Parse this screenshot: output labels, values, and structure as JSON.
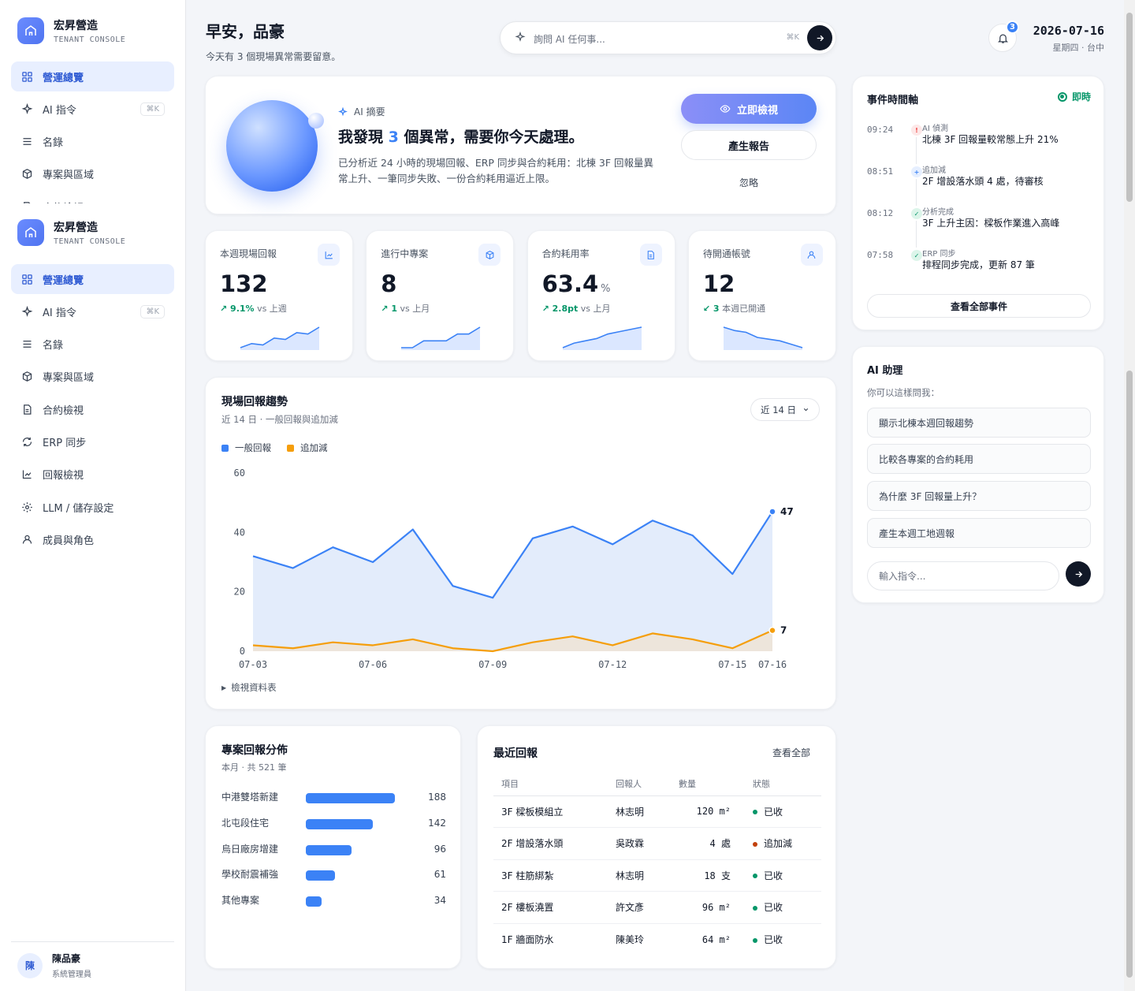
{
  "sidebar": {
    "brand_name": "宏昇營造",
    "brand_sub": "TENANT CONSOLE",
    "items": [
      {
        "label": "營運總覽",
        "icon": "grid-icon"
      },
      {
        "label": "AI 指令",
        "icon": "sparkle-icon",
        "kbd": "⌘K"
      },
      {
        "label": "名錄",
        "icon": "list-icon"
      },
      {
        "label": "專案與區域",
        "icon": "box-icon"
      },
      {
        "label": "合約檢視",
        "icon": "document-icon"
      },
      {
        "label": "ERP 同步",
        "icon": "sync-icon"
      },
      {
        "label": "回報檢視",
        "icon": "chart-icon"
      },
      {
        "label": "LLM / 儲存設定",
        "icon": "gear-icon"
      },
      {
        "label": "成員與角色",
        "icon": "user-icon"
      }
    ],
    "user": {
      "initial": "陳",
      "name": "陳品豪",
      "role": "系統管理員"
    }
  },
  "header": {
    "greeting": "早安，品豪",
    "subtitle": "今天有 3 個現場異常需要留意。",
    "search_placeholder": "詢問 AI 任何事...",
    "search_kbd": "⌘K",
    "notification_count": "3",
    "date": "2026-07-16",
    "weekday_location": "星期四 · 台中"
  },
  "ai_summary": {
    "tag": "AI 摘要",
    "headline_pre": "我發現 ",
    "headline_num": "3",
    "headline_post": " 個異常，需要你今天處理。",
    "body": "已分析近 24 小時的現場回報、ERP 同步與合約耗用：北棟 3F 回報量異常上升、一筆同步失敗、一份合約耗用逼近上限。",
    "primary_action": "立即檢視",
    "secondary_action": "產生報告",
    "dismiss": "忽略"
  },
  "kpis": [
    {
      "label": "本週現場回報",
      "value": "132",
      "unit": "",
      "delta": "↗ 9.1%",
      "delta_text": "vs 上週",
      "icon": "chart-icon",
      "trend": "up",
      "spark": [
        5,
        8,
        7,
        12,
        11,
        16,
        15,
        20
      ]
    },
    {
      "label": "進行中專案",
      "value": "8",
      "unit": "",
      "delta": "↗ 1",
      "delta_text": "vs 上月",
      "icon": "box-icon",
      "trend": "up",
      "spark": [
        6,
        6,
        10,
        10,
        10,
        14,
        14,
        18
      ]
    },
    {
      "label": "合約耗用率",
      "value": "63.4",
      "unit": "%",
      "delta": "↗ 2.8pt",
      "delta_text": "vs 上月",
      "icon": "document-icon",
      "trend": "up",
      "spark": [
        8,
        10,
        11,
        12,
        14,
        15,
        16,
        17
      ]
    },
    {
      "label": "待開通帳號",
      "value": "12",
      "unit": "",
      "delta": "↙ 3",
      "delta_text": "本週已開通",
      "icon": "user-icon",
      "trend": "down",
      "spark": [
        20,
        18,
        17,
        14,
        13,
        12,
        10,
        8
      ]
    }
  ],
  "trend": {
    "title": "現場回報趨勢",
    "subtitle": "近 14 日 · 一般回報與追加減",
    "range": "近 14 日",
    "table_toggle": "檢視資料表"
  },
  "chart_data": {
    "type": "area",
    "categories": [
      "07-03",
      "07-04",
      "07-05",
      "07-06",
      "07-07",
      "07-08",
      "07-09",
      "07-10",
      "07-11",
      "07-12",
      "07-13",
      "07-14",
      "07-15",
      "07-16"
    ],
    "x_ticks": [
      "07-03",
      "07-06",
      "07-09",
      "07-12",
      "07-15",
      "07-16"
    ],
    "series": [
      {
        "name": "一般回報",
        "color": "#3b82f6",
        "values": [
          32,
          28,
          35,
          30,
          41,
          22,
          18,
          38,
          42,
          36,
          44,
          39,
          26,
          47
        ]
      },
      {
        "name": "追加減",
        "color": "#f59e0b",
        "values": [
          2,
          1,
          3,
          2,
          4,
          1,
          0,
          3,
          5,
          2,
          6,
          4,
          1,
          7
        ]
      }
    ],
    "y_ticks": [
      0,
      20,
      40,
      60
    ],
    "ylim": [
      0,
      60
    ],
    "end_labels": [
      "47",
      "7"
    ],
    "grid": false,
    "legend": "top-left"
  },
  "distribution": {
    "title": "專案回報分佈",
    "subtitle": "本月 · 共 521 筆",
    "rows": [
      {
        "name": "中港雙塔新建",
        "value": 188
      },
      {
        "name": "北屯段住宅",
        "value": 142
      },
      {
        "name": "烏日廠房增建",
        "value": 96
      },
      {
        "name": "學校耐震補強",
        "value": 61
      },
      {
        "name": "其他專案",
        "value": 34
      }
    ]
  },
  "recent": {
    "title": "最近回報",
    "view_all": "查看全部",
    "headers": [
      "項目",
      "回報人",
      "數量",
      "狀態"
    ],
    "rows": [
      {
        "item": "3F 樑板模組立",
        "reporter": "林志明",
        "qty": "120 m²",
        "status": "已收",
        "status_color": "#059669"
      },
      {
        "item": "2F 增設落水頭",
        "reporter": "吳政霖",
        "qty": "4 處",
        "status": "追加減",
        "status_color": "#c2410c"
      },
      {
        "item": "3F 柱筋綁紮",
        "reporter": "林志明",
        "qty": "18 支",
        "status": "已收",
        "status_color": "#059669"
      },
      {
        "item": "2F 樓板澆置",
        "reporter": "許文彥",
        "qty": "96 m²",
        "status": "已收",
        "status_color": "#059669"
      },
      {
        "item": "1F 牆面防水",
        "reporter": "陳美玲",
        "qty": "64 m²",
        "status": "已收",
        "status_color": "#059669"
      }
    ]
  },
  "timeline": {
    "title": "事件時間軸",
    "live": "即時",
    "items": [
      {
        "time": "09:24",
        "tag": "AI 偵測",
        "text": "北棟 3F 回報量較常態上升 21%",
        "kind": "alert"
      },
      {
        "time": "08:51",
        "tag": "追加減",
        "text": "2F 增設落水頭 4 處，待審核",
        "kind": "add"
      },
      {
        "time": "08:12",
        "tag": "分析完成",
        "text": "3F 上升主因：樑板作業進入高峰",
        "kind": "done"
      },
      {
        "time": "07:58",
        "tag": "ERP 同步",
        "text": "排程同步完成，更新 87 筆",
        "kind": "done"
      }
    ],
    "view_all": "查看全部事件"
  },
  "assistant": {
    "title": "AI 助理",
    "hint": "你可以這樣問我：",
    "suggestions": [
      "顯示北棟本週回報趨勢",
      "比較各專案的合約耗用",
      "為什麼 3F 回報量上升？",
      "產生本週工地週報"
    ],
    "input_placeholder": "輸入指令..."
  },
  "colors": {
    "accent": "#3b82f6",
    "secondary": "#f59e0b",
    "success": "#059669",
    "alert": "#ef4444"
  }
}
